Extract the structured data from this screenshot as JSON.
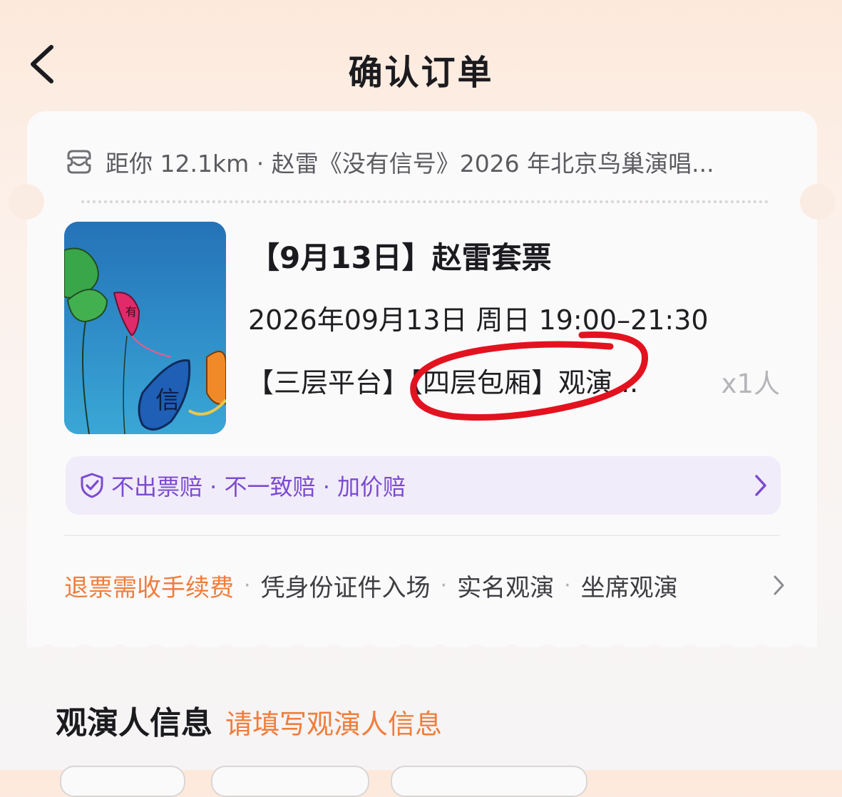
{
  "header": {
    "title": "确认订单",
    "back_icon": "chevron-left-icon"
  },
  "venue": {
    "icon": "venue-icon",
    "text": "距你 12.1km · 赵雷《没有信号》2026 年北京鸟巢演唱..."
  },
  "ticket": {
    "title": "【9月13日】赵雷套票",
    "datetime": "2026年09月13日  周日  19:00–21:30",
    "seat": "【三层平台】【四层包厢】观演...",
    "quantity": "x1人",
    "annotation_color": "#e3121f"
  },
  "guarantee": {
    "text": "不出票赔 · 不一致赔 · 加价赔",
    "icon": "shield-check-icon",
    "color": "#7b4bd0"
  },
  "policies": {
    "refund": "退票需收手续费",
    "items": [
      "凭身份证件入场",
      "实名观演",
      "坐席观演"
    ],
    "separator": "·",
    "accent_color": "#ef7d3c"
  },
  "viewer_section": {
    "heading": "观演人信息",
    "hint": "请填写观演人信息"
  }
}
